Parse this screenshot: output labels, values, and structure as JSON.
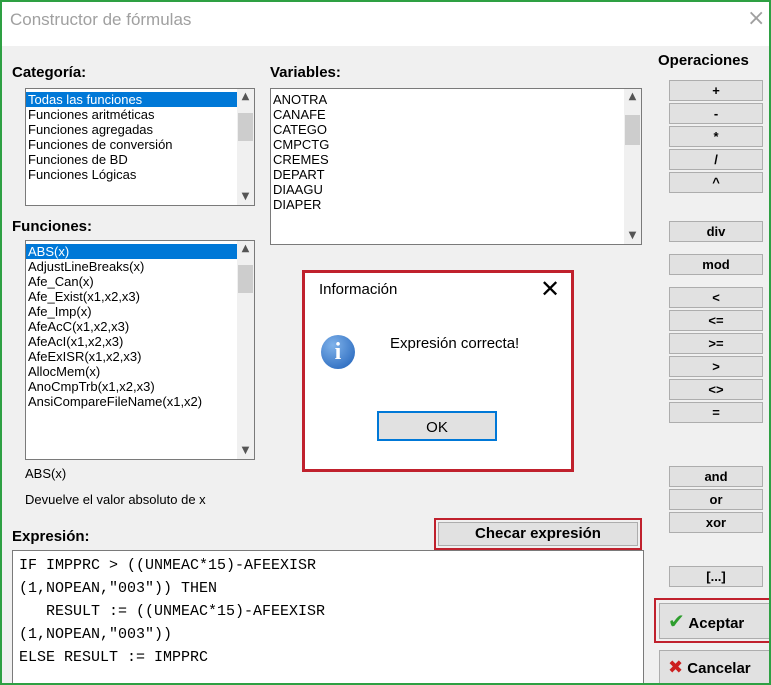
{
  "window": {
    "title": "Constructor de fórmulas",
    "close_glyph": "×"
  },
  "categoria": {
    "label": "Categoría:",
    "items": [
      "Todas las funciones",
      "Funciones aritméticas",
      "Funciones agregadas",
      "Funciones de conversión",
      "Funciones de BD",
      "Funciones Lógicas"
    ],
    "selected": 0
  },
  "variables": {
    "label": "Variables:",
    "items": [
      "ANOTRA",
      "CANAFE",
      "CATEGO",
      "CMPCTG",
      "CREMES",
      "DEPART",
      "DIAAGU",
      "DIAPER"
    ]
  },
  "funciones": {
    "label": "Funciones:",
    "items": [
      "ABS(x)",
      "AdjustLineBreaks(x)",
      "Afe_Can(x)",
      "Afe_Exist(x1,x2,x3)",
      "Afe_Imp(x)",
      "AfeAcC(x1,x2,x3)",
      "AfeAcI(x1,x2,x3)",
      "AfeExISR(x1,x2,x3)",
      "AllocMem(x)",
      "AnoCmpTrb(x1,x2,x3)",
      "AnsiCompareFileName(x1,x2)"
    ],
    "selected": 0
  },
  "function_info": {
    "name": "ABS(x)",
    "description": "Devuelve el valor absoluto de x"
  },
  "expresion": {
    "label": "Expresión:",
    "check_button": "Checar expresión",
    "lines": [
      "IF IMPPRC > ((UNMEAC*15)-AFEEXISR",
      "(1,NOPEAN,\"003\")) THEN",
      "   RESULT := ((UNMEAC*15)-AFEEXISR",
      "(1,NOPEAN,\"003\"))",
      "ELSE RESULT := IMPPRC"
    ]
  },
  "operaciones": {
    "label": "Operaciones",
    "buttons": [
      "+",
      "-",
      "*",
      "/",
      "^",
      "div",
      "mod",
      "<",
      "<=",
      ">=",
      ">",
      "<>",
      "=",
      "and",
      "or",
      "xor",
      "[...]"
    ]
  },
  "actions": {
    "accept": "Aceptar",
    "cancel": "Cancelar",
    "accept_color": "#2e9e2e",
    "cancel_color": "#cc1f1f"
  },
  "dialog": {
    "title": "Información",
    "close_glyph": "✕",
    "message": "Expresión correcta!",
    "ok_label": "OK",
    "icon_glyph": "i"
  }
}
